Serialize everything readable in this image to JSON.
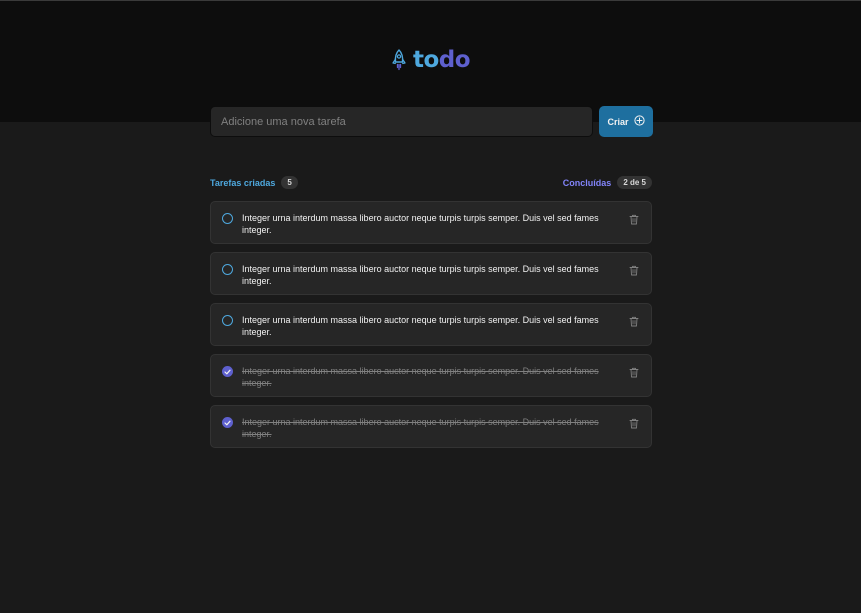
{
  "header": {
    "logo_part1": "to",
    "logo_part2": "do",
    "logo_icon": "rocket-icon"
  },
  "new_task": {
    "placeholder": "Adicione uma nova tarefa",
    "value": "",
    "button_label": "Criar",
    "button_icon": "plus-circle-icon"
  },
  "counters": {
    "created_label": "Tarefas criadas",
    "created_count": "5",
    "done_label": "Concluídas",
    "done_count": "2 de 5"
  },
  "tasks": [
    {
      "text": "Integer urna interdum massa libero auctor neque turpis turpis semper. Duis vel sed fames integer.",
      "done": false
    },
    {
      "text": "Integer urna interdum massa libero auctor neque turpis turpis semper. Duis vel sed fames integer.",
      "done": false
    },
    {
      "text": "Integer urna interdum massa libero auctor neque turpis turpis semper. Duis vel sed fames integer.",
      "done": false
    },
    {
      "text": "Integer urna interdum massa libero auctor neque turpis turpis semper. Duis vel sed fames integer.",
      "done": true
    },
    {
      "text": "Integer urna interdum massa libero auctor neque turpis turpis semper. Duis vel sed fames integer.",
      "done": true
    }
  ],
  "colors": {
    "blue": "#4ea8de",
    "purple": "#5e60ce",
    "purple_light": "#8284fa",
    "blue_dark": "#1e6f9f"
  }
}
